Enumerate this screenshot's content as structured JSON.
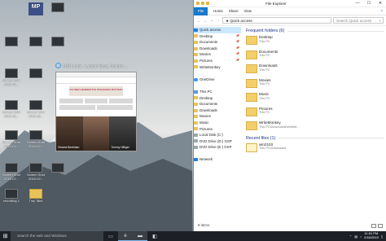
{
  "desktop": {
    "icons": [
      {
        "label": "",
        "kind": "mp",
        "text": "MP"
      },
      {
        "label": "",
        "kind": "screen"
      },
      {
        "label": "",
        "kind": "screen"
      },
      {
        "label": "",
        "kind": "screen"
      },
      {
        "label": "Screen Shot 2015-02...",
        "kind": "screen"
      },
      {
        "label": "",
        "kind": "screen"
      },
      {
        "label": "",
        "kind": "screen"
      },
      {
        "label": "Screen Shot 2015-02...",
        "kind": "screen"
      },
      {
        "label": "Screen Shot 2015-02...",
        "kind": "screen"
      },
      {
        "label": "Screen Shot 2015-02...",
        "kind": "screen"
      },
      {
        "label": "Screen Shot 2015-02...",
        "kind": "screen"
      },
      {
        "label": "Screen Shot 2015-02...",
        "kind": "screen"
      },
      {
        "label": "Screen Shot 2015-02...",
        "kind": "screen"
      },
      {
        "label": "",
        "kind": "screen"
      },
      {
        "label": "recording 1",
        "kind": "screen"
      },
      {
        "label": "Tiny Take",
        "kind": "fold"
      }
    ]
  },
  "thumbnail": {
    "title": "MSN India - Latest News, Outlook...",
    "banner": "ON NEW GENERATION PANASONIC BATTERY",
    "captions": [
      "Victoria Beckham",
      "Tommy Hilfiger"
    ]
  },
  "explorer": {
    "title": "File Explorer",
    "window_controls": [
      "—",
      "☐",
      "✕"
    ],
    "ribbon": {
      "file": "File",
      "tabs": [
        "Home",
        "Share",
        "View"
      ],
      "help": "?"
    },
    "address": {
      "path": "Quick access",
      "search_placeholder": "Search Quick access"
    },
    "nav": [
      {
        "label": "Quick access",
        "icon": "star-icon",
        "selected": true,
        "pin": false
      },
      {
        "label": "Desktop",
        "icon": "folder-icon",
        "pin": true
      },
      {
        "label": "Documents",
        "icon": "folder-icon",
        "pin": true
      },
      {
        "label": "Downloads",
        "icon": "folder-icon",
        "pin": true
      },
      {
        "label": "Movies",
        "icon": "folder-icon",
        "pin": true
      },
      {
        "label": "Pictures",
        "icon": "folder-icon",
        "pin": true
      },
      {
        "label": "WriteMonkey",
        "icon": "folder-icon",
        "pin": false
      },
      {
        "label": "",
        "icon": "",
        "pin": false
      },
      {
        "label": "OneDrive",
        "icon": "cloud-icon",
        "pin": false
      },
      {
        "label": "",
        "icon": "",
        "pin": false
      },
      {
        "label": "This PC",
        "icon": "pc-icon",
        "pin": false
      },
      {
        "label": "Desktop",
        "icon": "folder-icon",
        "pin": false
      },
      {
        "label": "Documents",
        "icon": "folder-icon",
        "pin": false
      },
      {
        "label": "Downloads",
        "icon": "folder-icon",
        "pin": false
      },
      {
        "label": "Movies",
        "icon": "folder-icon",
        "pin": false
      },
      {
        "label": "Music",
        "icon": "folder-icon",
        "pin": false
      },
      {
        "label": "Pictures",
        "icon": "folder-icon",
        "pin": false
      },
      {
        "label": "Local Disk (C:)",
        "icon": "disk-icon",
        "pin": false
      },
      {
        "label": "DVD Drive (D:) GSP",
        "icon": "disk-icon",
        "pin": false
      },
      {
        "label": "DVD Drive (E:) GSP",
        "icon": "disk-icon",
        "pin": false
      },
      {
        "label": "",
        "icon": "",
        "pin": false
      },
      {
        "label": "Network",
        "icon": "network-icon",
        "pin": false
      }
    ],
    "frequent_header": "Frequent folders (6)",
    "frequent": [
      {
        "name": "Desktop",
        "location": "This PC"
      },
      {
        "name": "Documents",
        "location": "This PC"
      },
      {
        "name": "Downloads",
        "location": "This PC"
      },
      {
        "name": "Movies",
        "location": "This PC"
      },
      {
        "name": "Music",
        "location": "This PC"
      },
      {
        "name": "Pictures",
        "location": "This PC"
      },
      {
        "name": "WriteMonkey",
        "location": "This PC\\Downloads\\WriteM..."
      }
    ],
    "recent_header": "Recent files (1)",
    "recent": [
      {
        "name": "win2103",
        "location": "This PC\\Downloads"
      }
    ],
    "status": "8 items"
  },
  "taskbar": {
    "search_placeholder": "Search the web and Windows",
    "time": "11:51 PM",
    "date": "2/18/2015"
  }
}
